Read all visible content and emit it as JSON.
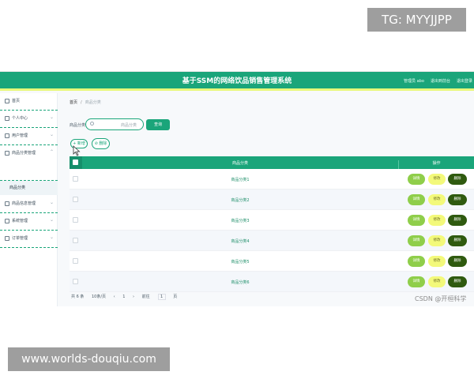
{
  "overlays": {
    "tg": "TG: MYYJJPP",
    "url": "www.worlds-douqiu.com",
    "watermark": "CSDN @开桓科学"
  },
  "header": {
    "title": "基于SSM的网络饮品销售管理系统",
    "admin": "管理员 abo",
    "back_home": "退出到前台",
    "logout": "退出登录"
  },
  "colors": {
    "primary": "#1aa57a",
    "accent_bar": "#e8f87a",
    "detail_button": "#8fce4a",
    "edit_button": "#f3f97a",
    "delete_button": "#2f5a0f"
  },
  "sidebar": {
    "items": [
      {
        "label": "首页",
        "icon": "home-icon"
      },
      {
        "label": "个人中心",
        "icon": "user-icon"
      },
      {
        "label": "用户管理",
        "icon": "users-icon"
      },
      {
        "label": "商品分类管理",
        "icon": "category-icon"
      },
      {
        "label": "商品信息管理",
        "icon": "goods-icon"
      },
      {
        "label": "系统管理",
        "icon": "settings-icon"
      },
      {
        "label": "订单管理",
        "icon": "orders-icon"
      }
    ],
    "submenu_label": "商品分类"
  },
  "breadcrumb": {
    "home": "首页",
    "current": "商品分类"
  },
  "search": {
    "label": "商品分类",
    "placeholder": "商品分类",
    "button": "查询"
  },
  "actions": {
    "add": "+ 新增",
    "delete": "⊘ 删除"
  },
  "table": {
    "headers": {
      "name": "商品分类",
      "operation": "操作"
    },
    "rows": [
      {
        "name": "商品分类1"
      },
      {
        "name": "商品分类2"
      },
      {
        "name": "商品分类3"
      },
      {
        "name": "商品分类4"
      },
      {
        "name": "商品分类5"
      },
      {
        "name": "商品分类6"
      }
    ],
    "row_buttons": {
      "detail": "详情",
      "edit": "修改",
      "delete": "删除"
    }
  },
  "pager": {
    "total": "共 6 条",
    "page_size": "10条/页",
    "page": "1",
    "goto_label": "前往",
    "goto_value": "1",
    "page_suffix": "页"
  }
}
